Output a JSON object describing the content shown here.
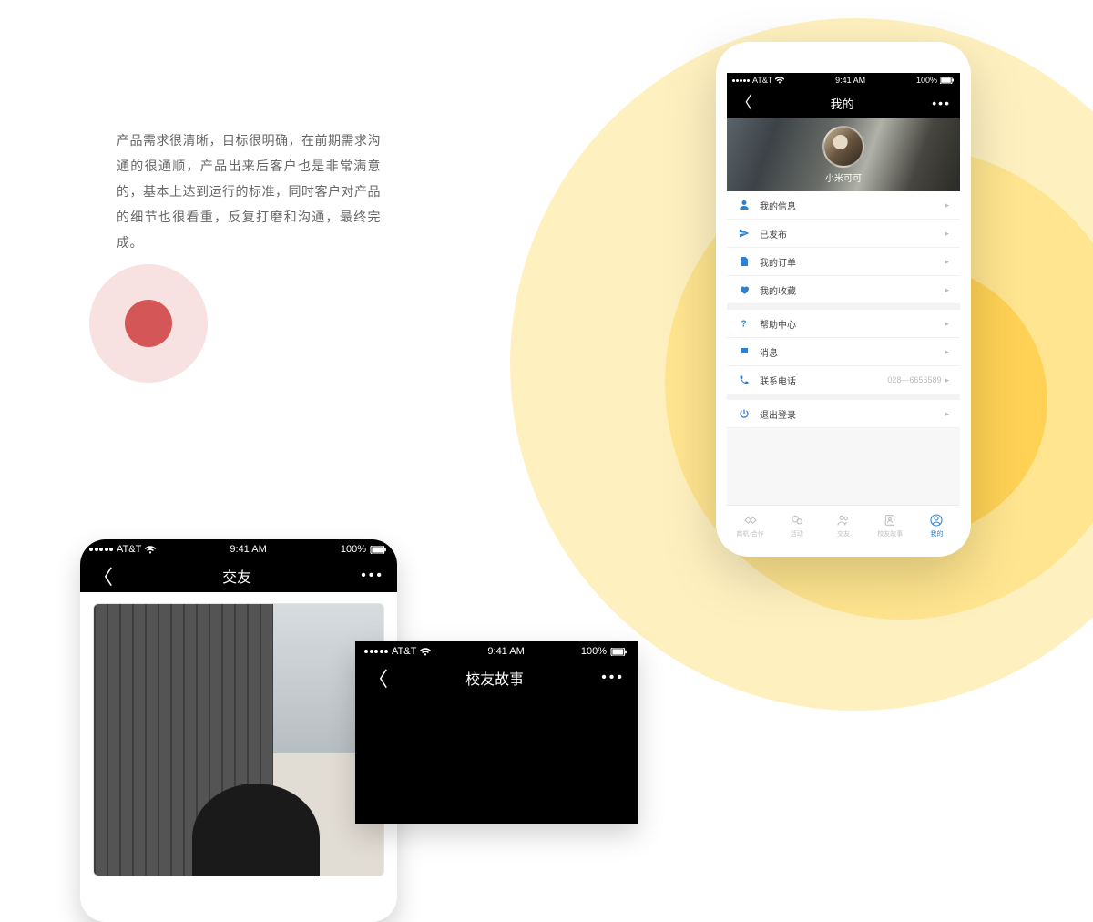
{
  "desc_text": "产品需求很清晰，目标很明确，在前期需求沟通的很通顺，产品出来后客户也是非常满意的，基本上达到运行的标准，同时客户对产品的细节也很看重，反复打磨和沟通，最终完成。",
  "phone1": {
    "status": {
      "carrier": "AT&T",
      "time": "9:41 AM",
      "battery": "100%"
    },
    "nav": {
      "title": "我的"
    },
    "hero": {
      "name": "小米可可"
    },
    "menu": [
      {
        "icon": "user",
        "label": "我的信息"
      },
      {
        "icon": "send",
        "label": "已发布"
      },
      {
        "icon": "doc",
        "label": "我的订单"
      },
      {
        "icon": "heart",
        "label": "我的收藏"
      },
      {
        "icon": "help",
        "label": "帮助中心"
      },
      {
        "icon": "msg",
        "label": "消息"
      },
      {
        "icon": "phone",
        "label": "联系电话",
        "extra": "028—6656589"
      },
      {
        "icon": "power",
        "label": "退出登录"
      }
    ],
    "tabs": [
      {
        "icon": "handshake",
        "label": "商机·合作"
      },
      {
        "icon": "chat",
        "label": "活动"
      },
      {
        "icon": "people",
        "label": "交友"
      },
      {
        "icon": "badge",
        "label": "校友故事"
      },
      {
        "icon": "me",
        "label": "我的",
        "active": true
      }
    ]
  },
  "phone2": {
    "status": {
      "carrier": "AT&T",
      "time": "9:41 AM",
      "battery": "100%"
    },
    "nav": {
      "title": "交友"
    }
  },
  "phone3": {
    "status": {
      "carrier": "AT&T",
      "time": "9:41 AM",
      "battery": "100%"
    },
    "nav": {
      "title": "校友故事"
    }
  }
}
